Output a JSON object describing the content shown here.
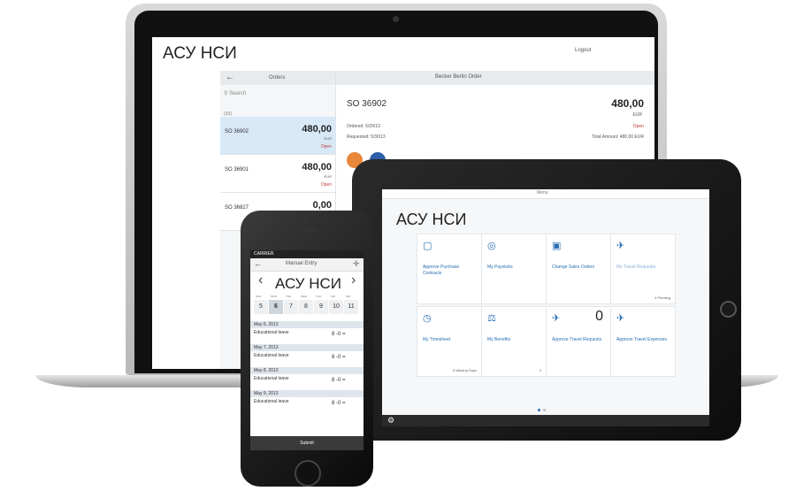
{
  "laptop": {
    "title": "АСУ НСИ",
    "logout": "Logout",
    "back": "←",
    "orders_title": "Orders",
    "search_placeholder": "Search",
    "count": "(10)",
    "orders": [
      {
        "id": "SO 36902",
        "amount": "480,00",
        "currency": "EUR",
        "status": "Open"
      },
      {
        "id": "SO 36901",
        "amount": "480,00",
        "currency": "EUR",
        "status": "Open"
      },
      {
        "id": "SO 36827",
        "amount": "0,00",
        "currency": "",
        "status": ""
      }
    ],
    "detail": {
      "title": "Becker Berlin Order",
      "so": "SO 36902",
      "amount": "480,00",
      "currency": "EUR",
      "ordered": "Ordered: 5/29/13",
      "status": "Open",
      "requested": "Requested: 5/30/13",
      "total": "Total Amount: 480,00 EUR"
    }
  },
  "tablet": {
    "menu": "Menu",
    "title": "АСУ НСИ",
    "tiles": [
      {
        "icon": "▢",
        "label": "Approve Purchase Contracts",
        "footer": "",
        "number": ""
      },
      {
        "icon": "◎",
        "label": "My Paystubs",
        "footer": "",
        "number": ""
      },
      {
        "icon": "▣",
        "label": "Change Sales Orders",
        "footer": "",
        "number": ""
      },
      {
        "icon": "✈",
        "label": "My Travel Requests",
        "footer": "4 Pending",
        "number": ""
      },
      {
        "icon": "◷",
        "label": "My Timesheet",
        "footer": "6 Missing Days",
        "number": ""
      },
      {
        "icon": "⚖",
        "label": "My Benefits",
        "footer": "4",
        "number": ""
      },
      {
        "icon": "✈",
        "label": "Approve Travel Requests",
        "footer": "",
        "number": "0"
      },
      {
        "icon": "✈",
        "label": "Approve Travel Expenses",
        "footer": "",
        "number": ""
      }
    ]
  },
  "phone": {
    "carrier": "CARRIER",
    "header": "Manual Entry",
    "title": "АСУ НСИ",
    "weekdays": [
      "SUN",
      "MON",
      "TUE",
      "WED",
      "THU",
      "FRI",
      "SAT"
    ],
    "dates": [
      "5",
      "6",
      "7",
      "8",
      "9",
      "10",
      "11"
    ],
    "entries": [
      {
        "date": "May 6, 2013",
        "label": "Educational leave",
        "value": "8 -0 ="
      },
      {
        "date": "May 7, 2013",
        "label": "Educational leave",
        "value": "8 -0 ="
      },
      {
        "date": "May 8, 2013",
        "label": "Educational leave",
        "value": "8 -0 ="
      },
      {
        "date": "May 9, 2013",
        "label": "Educational leave",
        "value": "8 -0 ="
      }
    ],
    "submit": "Submit"
  }
}
